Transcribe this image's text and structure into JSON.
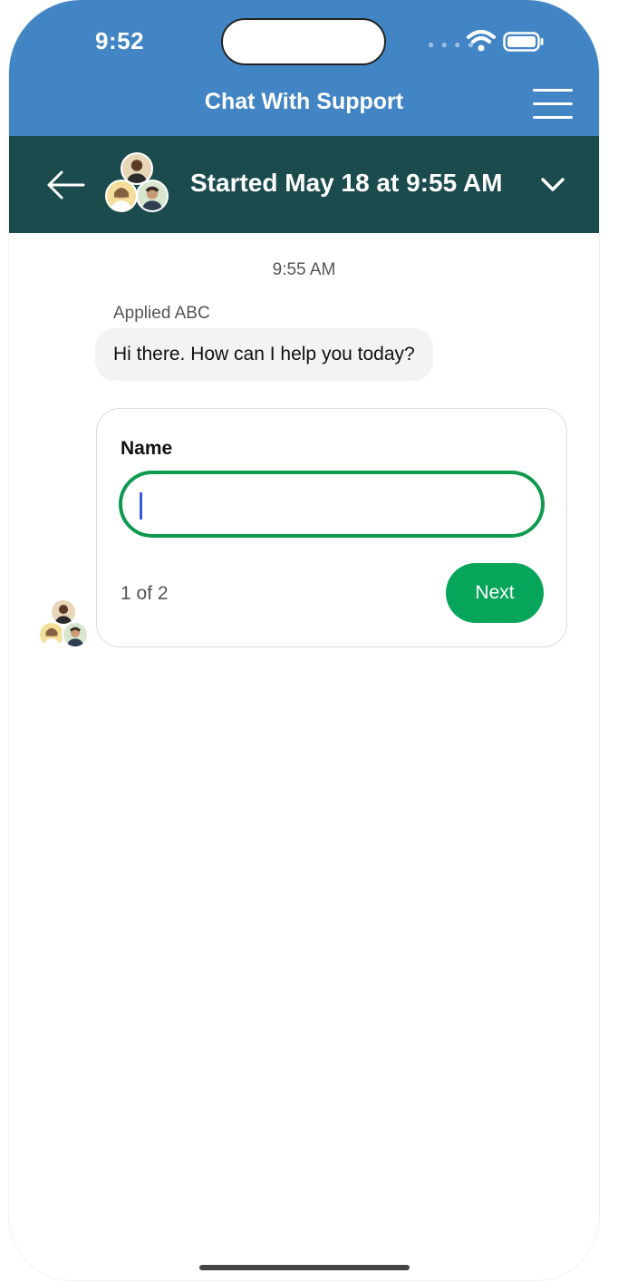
{
  "status_bar": {
    "time": "9:52",
    "signal_icon": "signal-dots-icon",
    "wifi_icon": "wifi-icon",
    "battery_icon": "battery-icon"
  },
  "app_bar": {
    "title": "Chat With Support",
    "menu_icon": "hamburger-menu-icon"
  },
  "chat_header": {
    "back_icon": "arrow-left-icon",
    "title": "Started May 18 at 9:55 AM",
    "expand_icon": "chevron-down-icon"
  },
  "conversation": {
    "timestamp": "9:55 AM",
    "sender": "Applied ABC",
    "message": "Hi there. How can I help you today?"
  },
  "form": {
    "field_label": "Name",
    "field_value": "",
    "field_placeholder": "",
    "step": "1 of 2",
    "next_label": "Next"
  },
  "colors": {
    "app_bar": "#4285c4",
    "chat_header": "#1b4b4d",
    "accent_green": "#07a55a",
    "input_border": "#0e9a4d"
  }
}
